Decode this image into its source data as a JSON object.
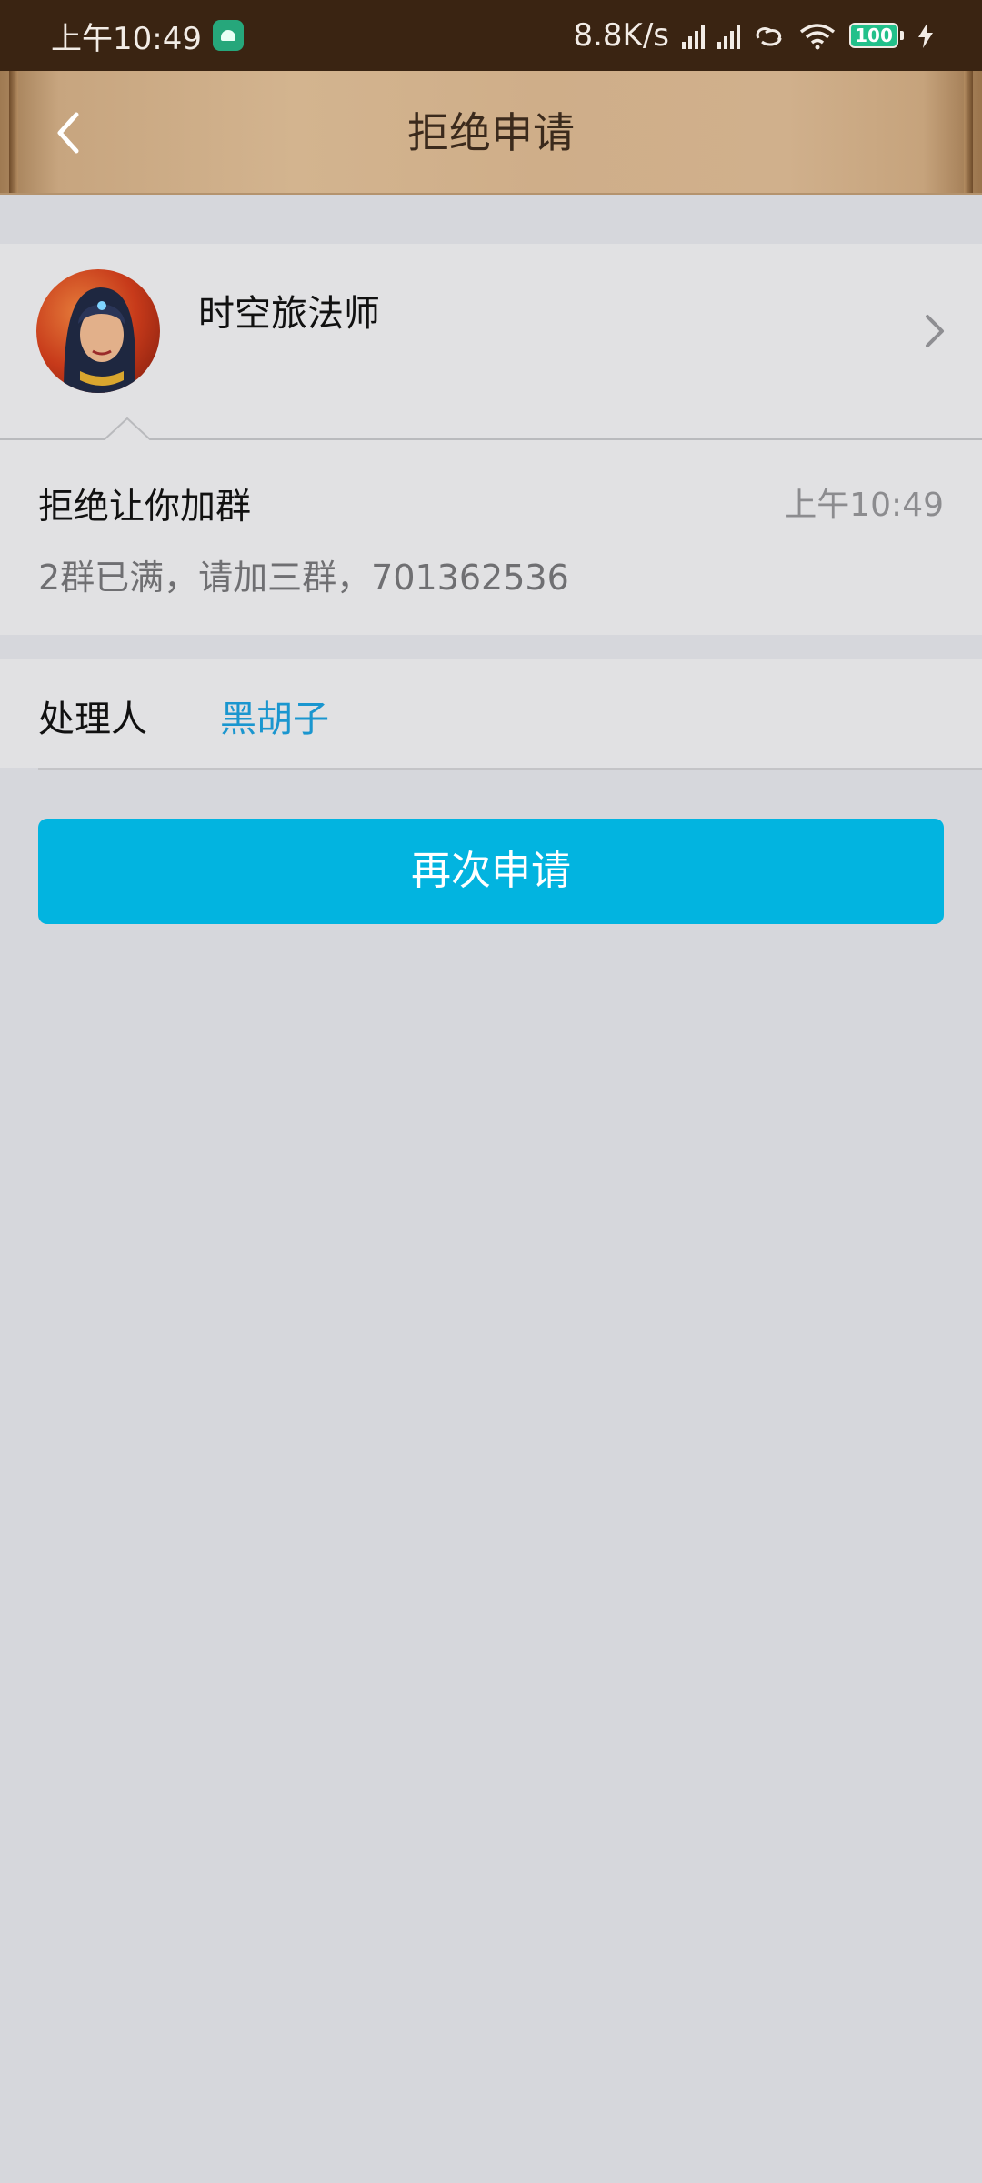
{
  "status_bar": {
    "time": "上午10:49",
    "net_speed": "8.8K/s",
    "battery": "100",
    "icons": [
      "app-notification-icon",
      "signal-icon",
      "signal-icon",
      "link-icon",
      "wifi-icon",
      "battery-icon",
      "charging-icon"
    ]
  },
  "header": {
    "title": "拒绝申请",
    "back_icon": "chevron-left-icon"
  },
  "profile": {
    "name": "时空旅法师",
    "chevron_icon": "chevron-right-icon"
  },
  "message": {
    "title": "拒绝让你加群",
    "time": "上午10:49",
    "body": "2群已满，请加三群，701362536"
  },
  "handler": {
    "label": "处理人",
    "name": "黑胡子"
  },
  "actions": {
    "reapply_label": "再次申请"
  },
  "colors": {
    "status_bar": "#3a2412",
    "button": "#02b4e0",
    "link": "#1a96cf",
    "background": "#d6d7dc"
  }
}
